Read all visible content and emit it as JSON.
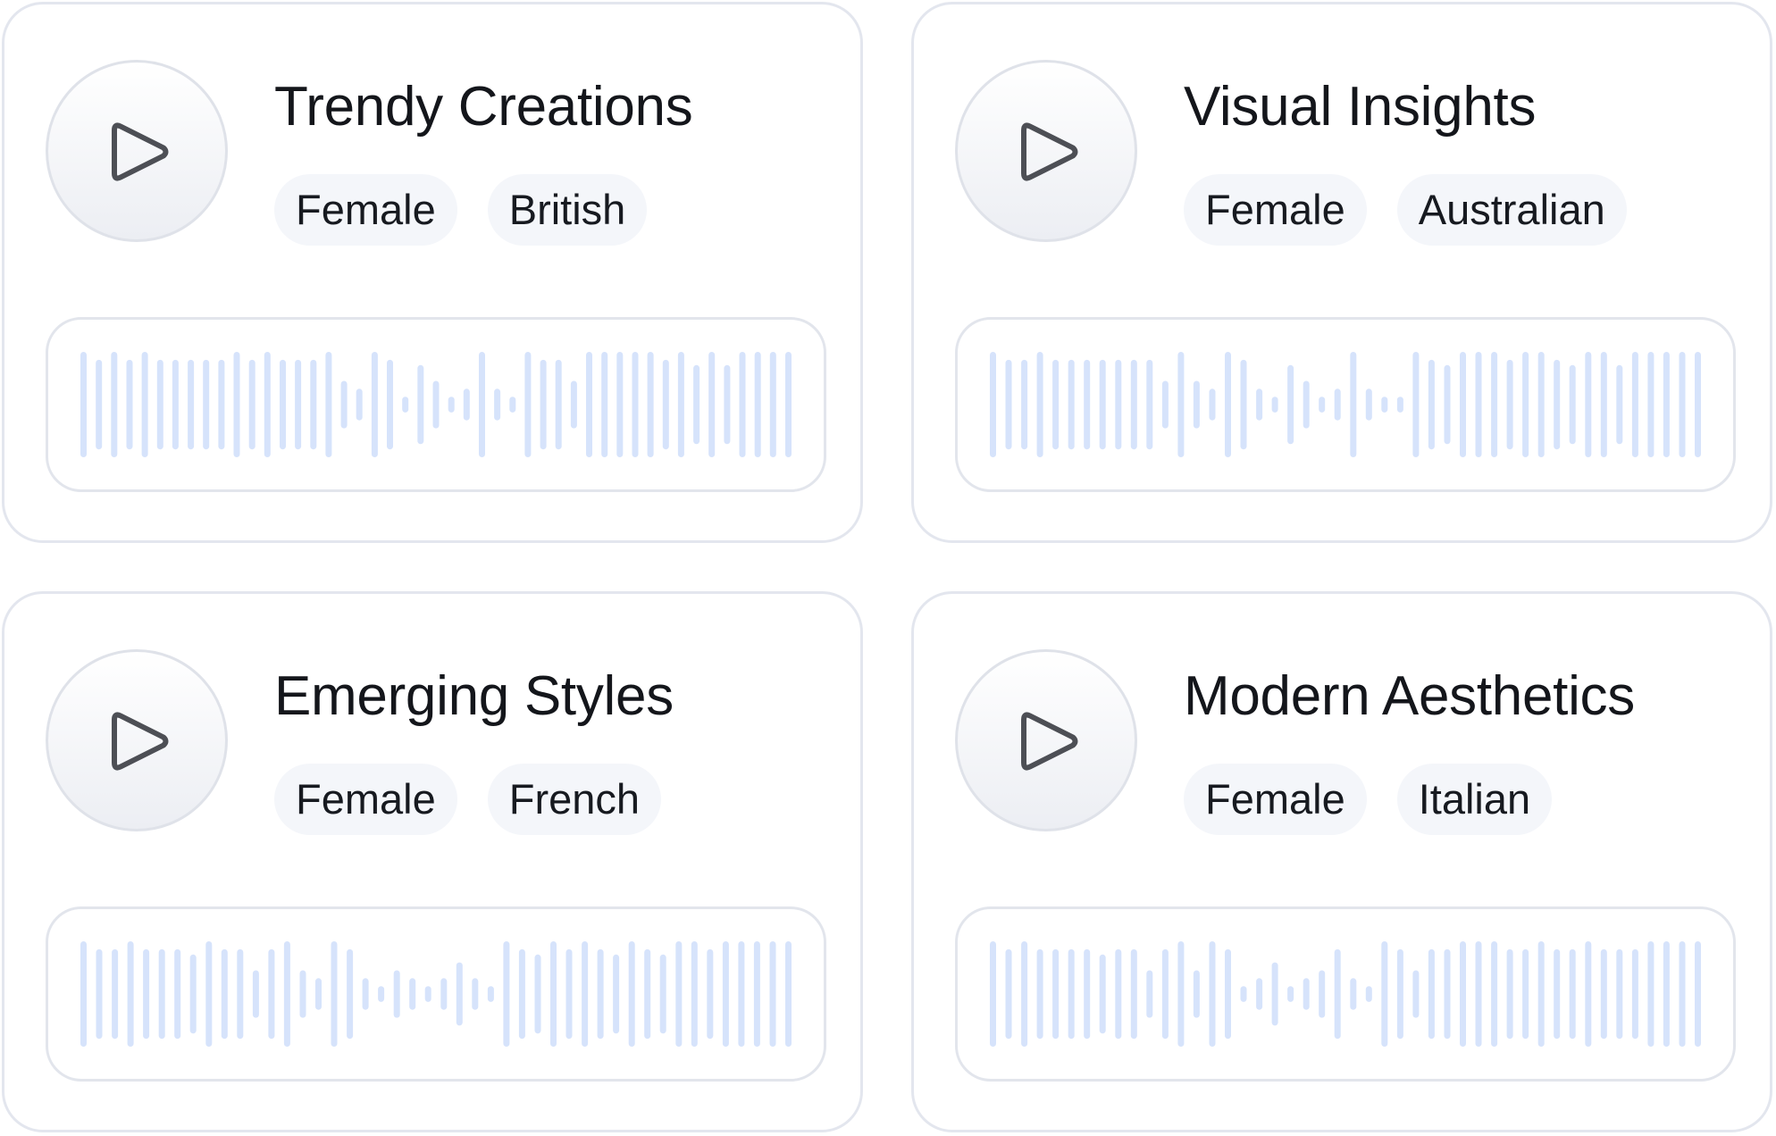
{
  "colors": {
    "card_border": "#e3e6ee",
    "tag_background": "#f4f6fa",
    "waveform_bar": "#d6e3fb",
    "play_icon": "#4d4f55",
    "text": "#14161b"
  },
  "icons": {
    "play": "play-icon"
  },
  "voices": [
    {
      "title": "Trendy Creations",
      "tags": [
        "Female",
        "British"
      ],
      "waveform_levels": [
        1,
        0.85,
        1,
        0.85,
        1,
        0.85,
        0.85,
        0.85,
        0.85,
        0.85,
        1,
        0.85,
        1,
        0.85,
        0.85,
        0.85,
        1,
        0.45,
        0.3,
        1,
        0.85,
        0.15,
        0.75,
        0.45,
        0.15,
        0.3,
        1,
        0.3,
        0.15,
        1,
        0.85,
        0.85,
        0.45,
        1,
        1,
        1,
        1,
        1,
        0.85,
        1,
        0.75,
        1,
        0.75,
        1,
        1,
        1,
        1
      ]
    },
    {
      "title": "Visual Insights",
      "tags": [
        "Female",
        "Australian"
      ],
      "waveform_levels": [
        1,
        0.85,
        0.85,
        1,
        0.85,
        0.85,
        0.85,
        0.85,
        0.85,
        0.85,
        0.85,
        0.45,
        1,
        0.45,
        0.3,
        1,
        0.85,
        0.3,
        0.15,
        0.75,
        0.45,
        0.15,
        0.3,
        1,
        0.3,
        0.15,
        0.15,
        1,
        0.85,
        0.75,
        1,
        1,
        1,
        0.85,
        1,
        1,
        0.85,
        0.75,
        1,
        1,
        0.75,
        1,
        1,
        1,
        1,
        1
      ]
    },
    {
      "title": "Emerging Styles",
      "tags": [
        "Female",
        "French"
      ],
      "waveform_levels": [
        1,
        0.85,
        0.85,
        1,
        0.85,
        0.85,
        0.85,
        0.75,
        1,
        0.85,
        0.85,
        0.45,
        0.85,
        1,
        0.45,
        0.3,
        1,
        0.85,
        0.3,
        0.15,
        0.45,
        0.3,
        0.15,
        0.3,
        0.6,
        0.3,
        0.15,
        1,
        0.85,
        0.75,
        1,
        0.85,
        1,
        0.85,
        0.75,
        1,
        0.85,
        0.75,
        1,
        1,
        0.85,
        1,
        1,
        1,
        1,
        1
      ]
    },
    {
      "title": "Modern Aesthetics",
      "tags": [
        "Female",
        "Italian"
      ],
      "waveform_levels": [
        1,
        0.85,
        1,
        0.85,
        0.85,
        0.85,
        0.85,
        0.75,
        0.85,
        0.85,
        0.45,
        0.85,
        1,
        0.45,
        1,
        0.85,
        0.15,
        0.3,
        0.6,
        0.15,
        0.3,
        0.45,
        0.85,
        0.3,
        0.15,
        1,
        0.85,
        0.45,
        0.85,
        0.85,
        1,
        1,
        1,
        0.85,
        0.85,
        1,
        0.85,
        0.85,
        1,
        0.85,
        0.85,
        0.85,
        1,
        1,
        1,
        1
      ]
    }
  ]
}
